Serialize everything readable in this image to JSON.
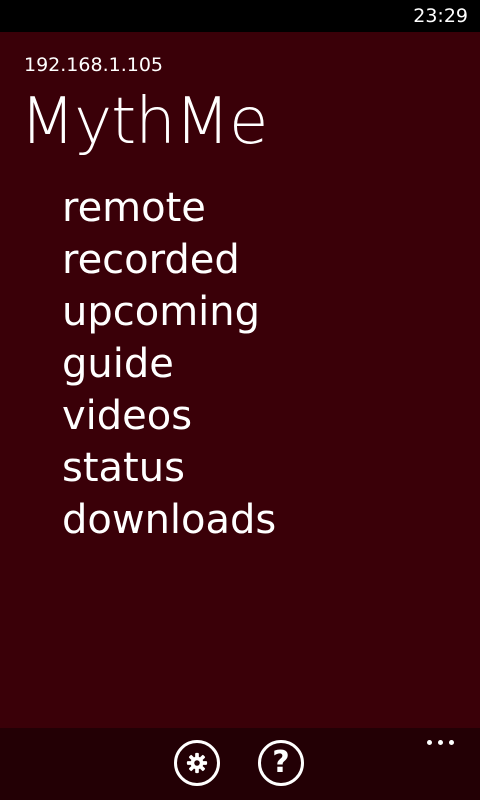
{
  "status_bar": {
    "time": "23:29"
  },
  "header": {
    "server_address": "192.168.1.105",
    "app_title": "MythMe"
  },
  "menu": {
    "items": [
      {
        "label": "remote"
      },
      {
        "label": "recorded"
      },
      {
        "label": "upcoming"
      },
      {
        "label": "guide"
      },
      {
        "label": "videos"
      },
      {
        "label": "status"
      },
      {
        "label": "downloads"
      }
    ]
  },
  "app_bar": {
    "buttons": [
      {
        "icon": "settings-icon"
      },
      {
        "icon": "help-icon",
        "glyph": "?"
      }
    ],
    "more": {
      "icon": "more-icon"
    }
  },
  "colors": {
    "background": "#3a0008",
    "app_bar": "#230005",
    "status_bar": "#000000",
    "text": "#ffffff"
  }
}
